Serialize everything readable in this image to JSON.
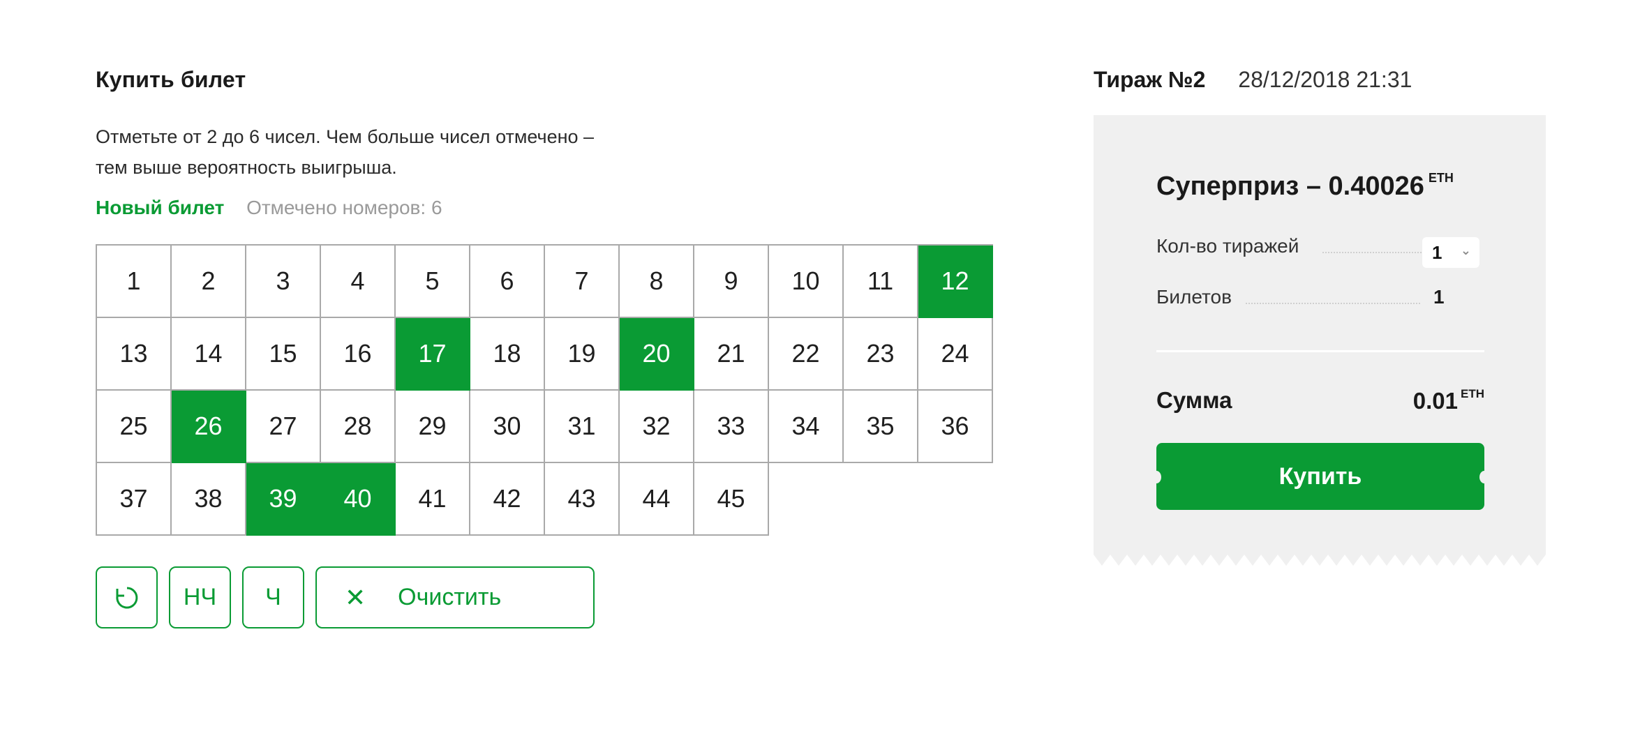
{
  "buy": {
    "title": "Купить билет",
    "instructions": "Отметьте от 2 до 6 чисел. Чем больше чисел отмечено – тем выше вероятность выигрыша.",
    "new_ticket": "Новый билет",
    "marked_count": "Отмечено номеров: 6"
  },
  "grid": {
    "numbers": [
      "1",
      "2",
      "3",
      "4",
      "5",
      "6",
      "7",
      "8",
      "9",
      "10",
      "11",
      "12",
      "13",
      "14",
      "15",
      "16",
      "17",
      "18",
      "19",
      "20",
      "21",
      "22",
      "23",
      "24",
      "25",
      "26",
      "27",
      "28",
      "29",
      "30",
      "31",
      "32",
      "33",
      "34",
      "35",
      "36",
      "37",
      "38",
      "39",
      "40",
      "41",
      "42",
      "43",
      "44",
      "45"
    ],
    "selected": [
      "12",
      "17",
      "20",
      "26",
      "39",
      "40"
    ]
  },
  "actions": {
    "refresh_icon": "refresh-icon",
    "odd_label": "НЧ",
    "even_label": "Ч",
    "clear_icon": "close-icon",
    "clear_label": "Очистить"
  },
  "draw": {
    "title": "Тираж №2",
    "date": "28/12/2018 21:31"
  },
  "summary": {
    "prize_label": "Суперприз – 0.40026",
    "prize_unit": "ETH",
    "draws_label": "Кол-во тиражей",
    "draws_value": "1",
    "tickets_label": "Билетов",
    "tickets_value": "1",
    "sum_label": "Сумма",
    "sum_value": "0.01",
    "sum_unit": "ETH",
    "buy_label": "Купить"
  },
  "colors": {
    "accent": "#0a9b34",
    "receipt_bg": "#f0f0f0"
  }
}
